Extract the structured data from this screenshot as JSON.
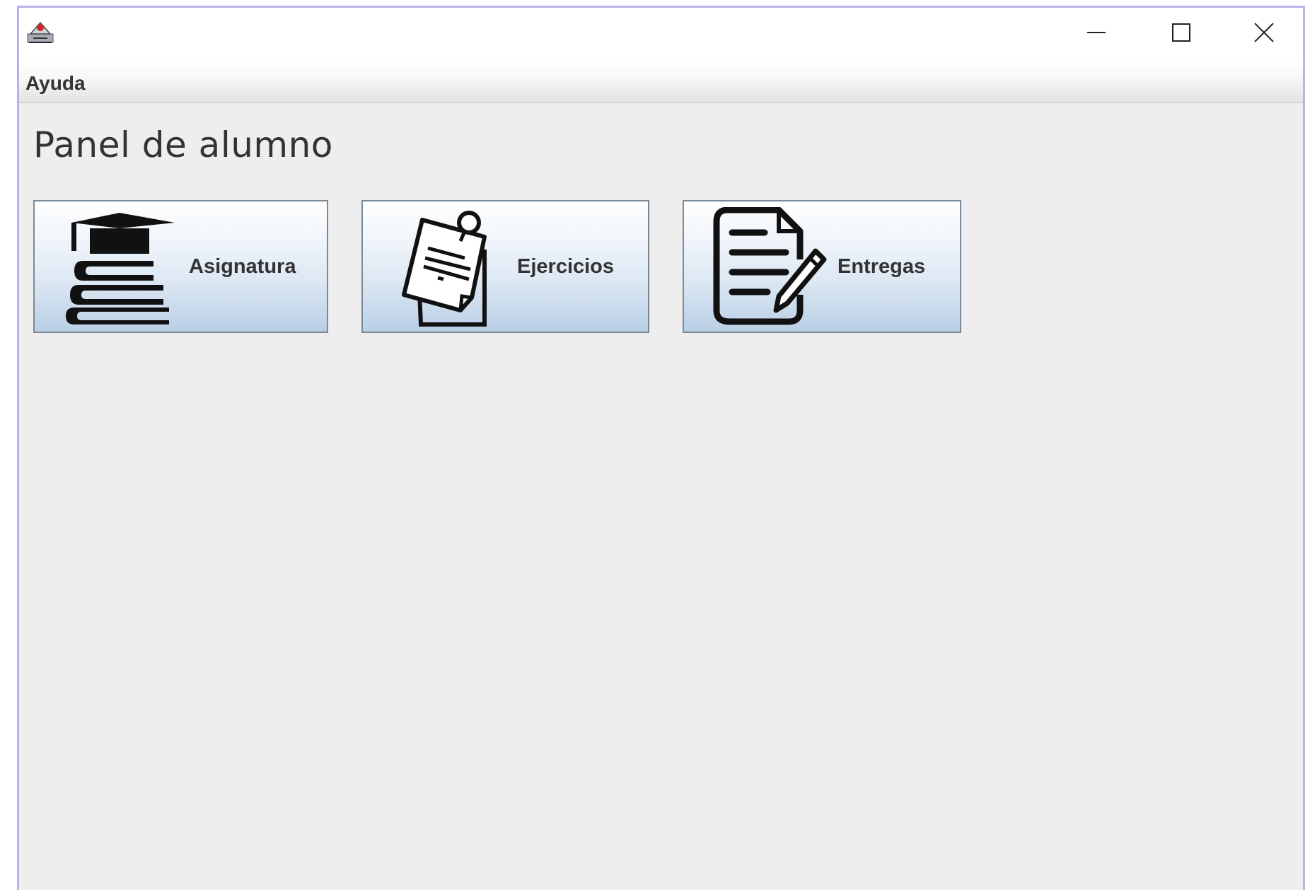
{
  "window": {
    "app_icon": "java-app-icon",
    "controls": {
      "minimize_icon": "minimize-icon",
      "maximize_icon": "maximize-icon",
      "close_icon": "close-icon"
    }
  },
  "menubar": {
    "items": [
      {
        "label": "Ayuda"
      }
    ]
  },
  "main": {
    "title": "Panel de alumno",
    "tiles": [
      {
        "label": "Asignatura",
        "icon": "graduation-books-icon"
      },
      {
        "label": "Ejercicios",
        "icon": "pinned-note-icon"
      },
      {
        "label": "Entregas",
        "icon": "document-pen-icon"
      }
    ]
  },
  "colors": {
    "window_border": "#b9b1ea",
    "content_bg": "#eeeeee",
    "tile_gradient_top": "#ffffff",
    "tile_gradient_bottom": "#bacfe6",
    "tile_border": "#7a8a99",
    "text": "#333333"
  }
}
